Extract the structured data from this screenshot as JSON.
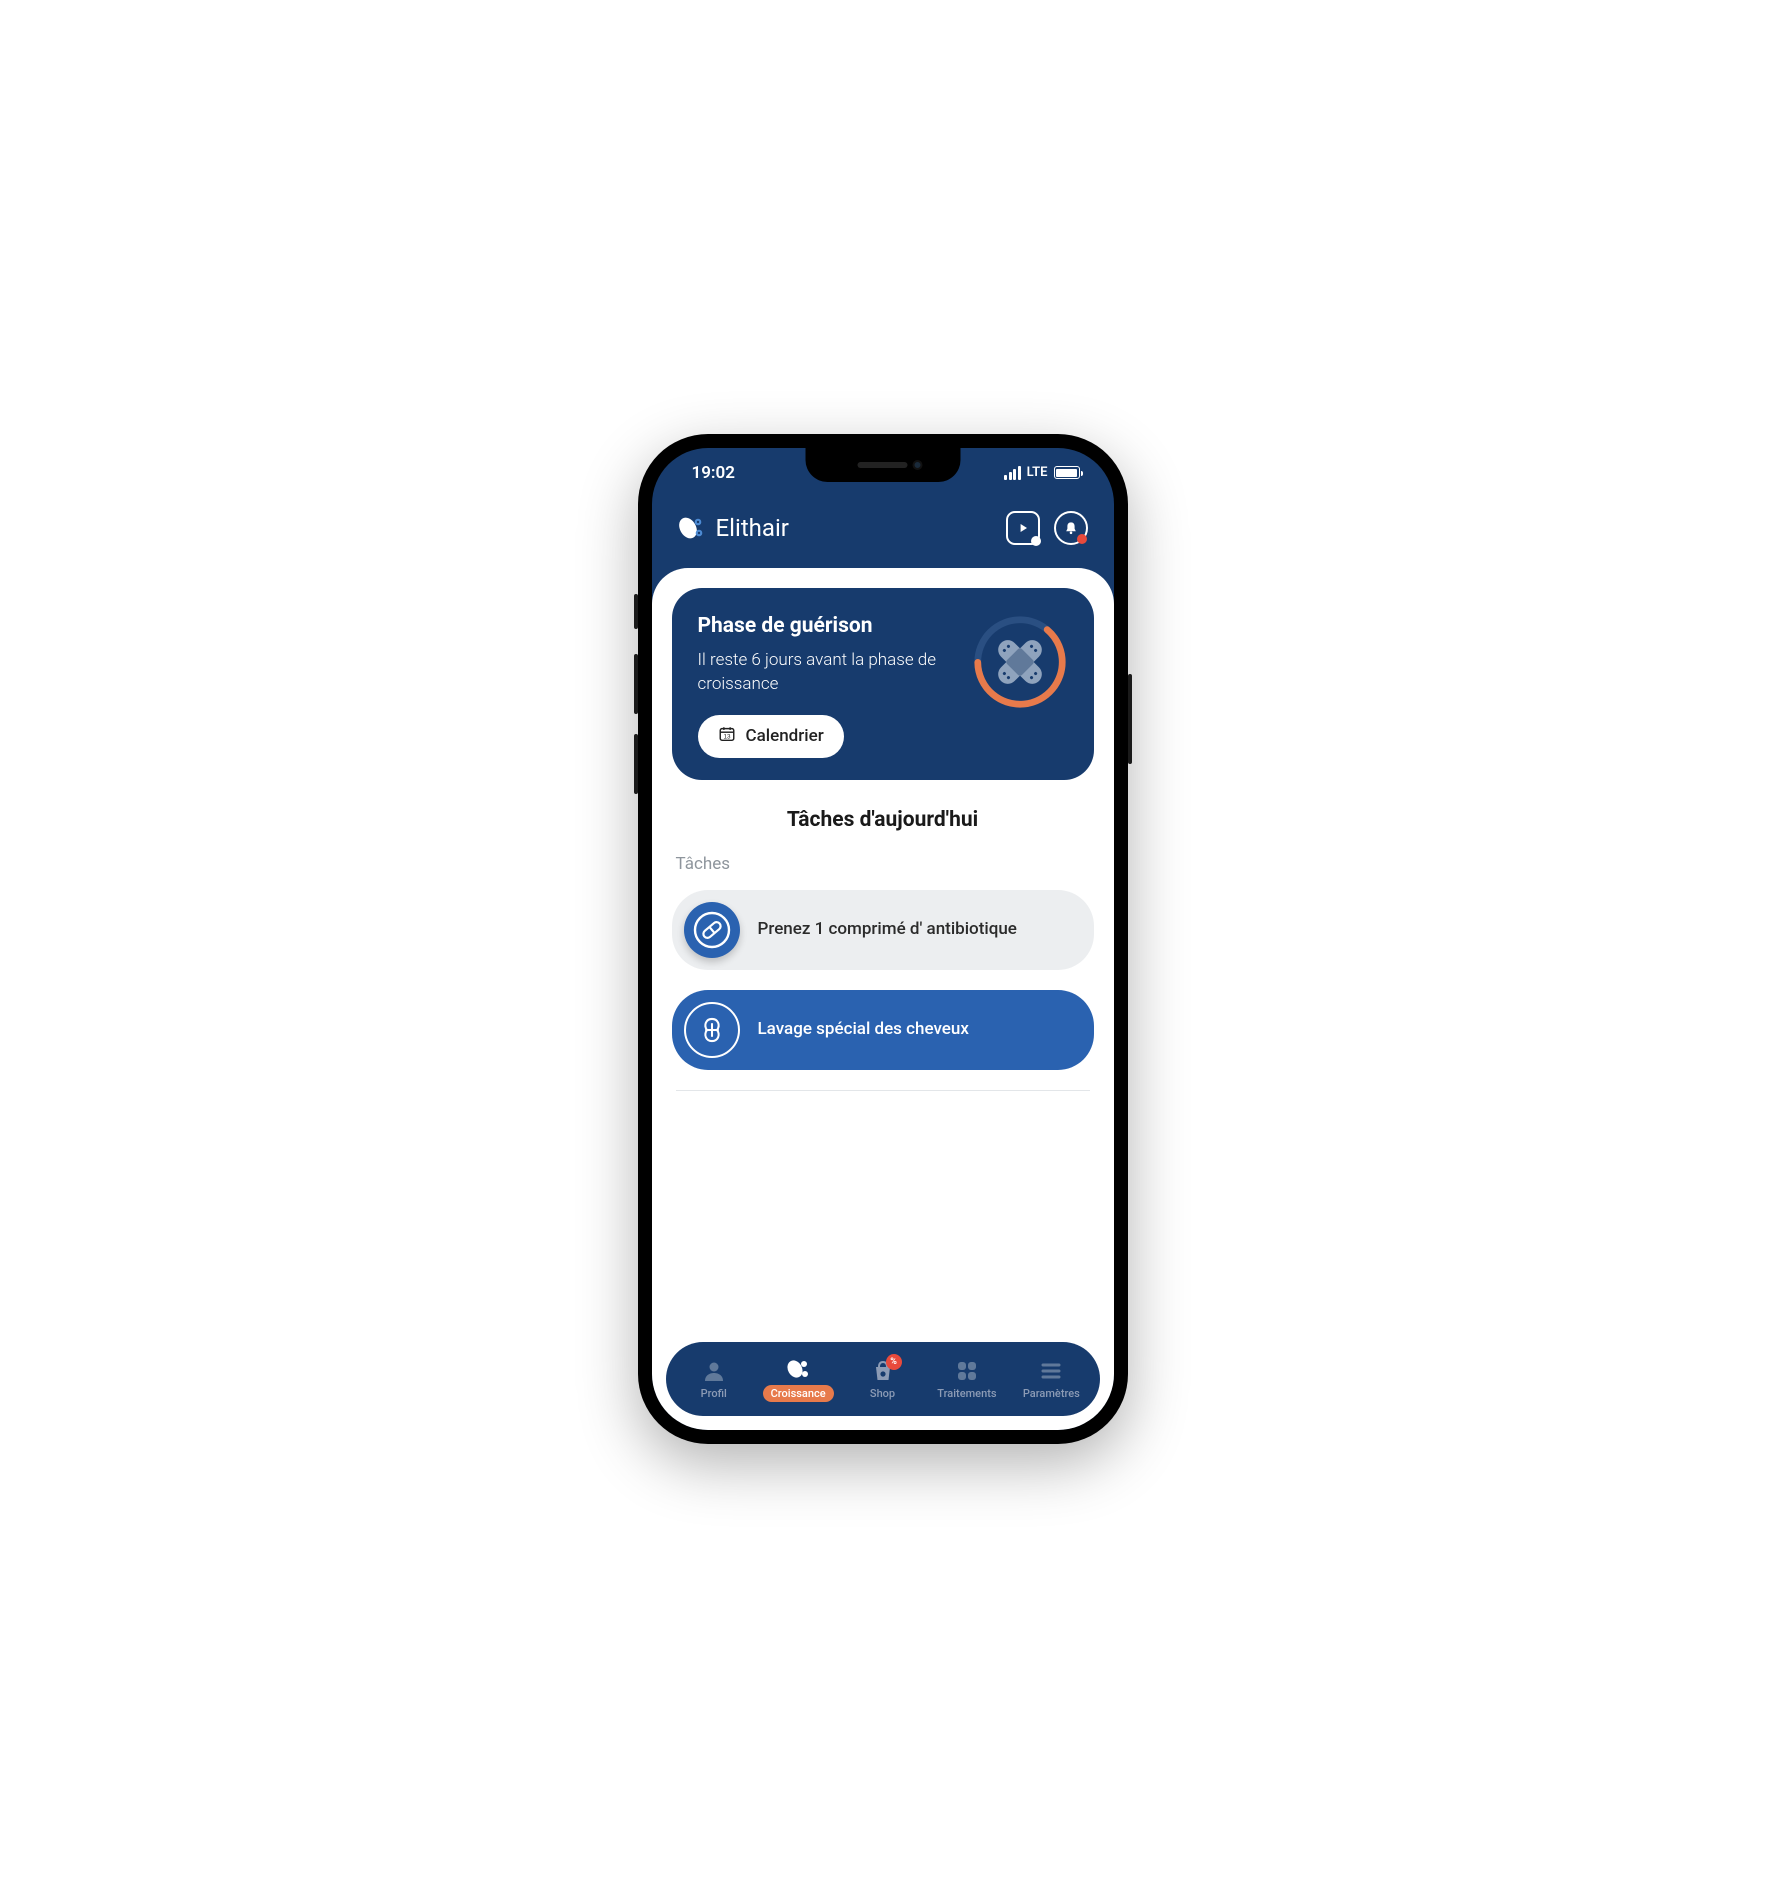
{
  "status_bar": {
    "time": "19:02",
    "network": "LTE"
  },
  "header": {
    "brand": "Elithair"
  },
  "phase_card": {
    "title": "Phase de guérison",
    "subtitle": "Il reste 6 jours avant la phase de croissance",
    "calendar_label": "Calendrier"
  },
  "tasks_section": {
    "heading": "Tâches d'aujourd'hui",
    "label": "Tâches",
    "items": [
      {
        "text": "Prenez 1 comprimé d' antibiotique"
      },
      {
        "text": "Lavage spécial des cheveux"
      }
    ]
  },
  "nav": {
    "items": [
      {
        "label": "Profil"
      },
      {
        "label": "Croissance"
      },
      {
        "label": "Shop",
        "badge": "%"
      },
      {
        "label": "Traitements"
      },
      {
        "label": "Paramètres"
      }
    ],
    "active_index": 1
  }
}
